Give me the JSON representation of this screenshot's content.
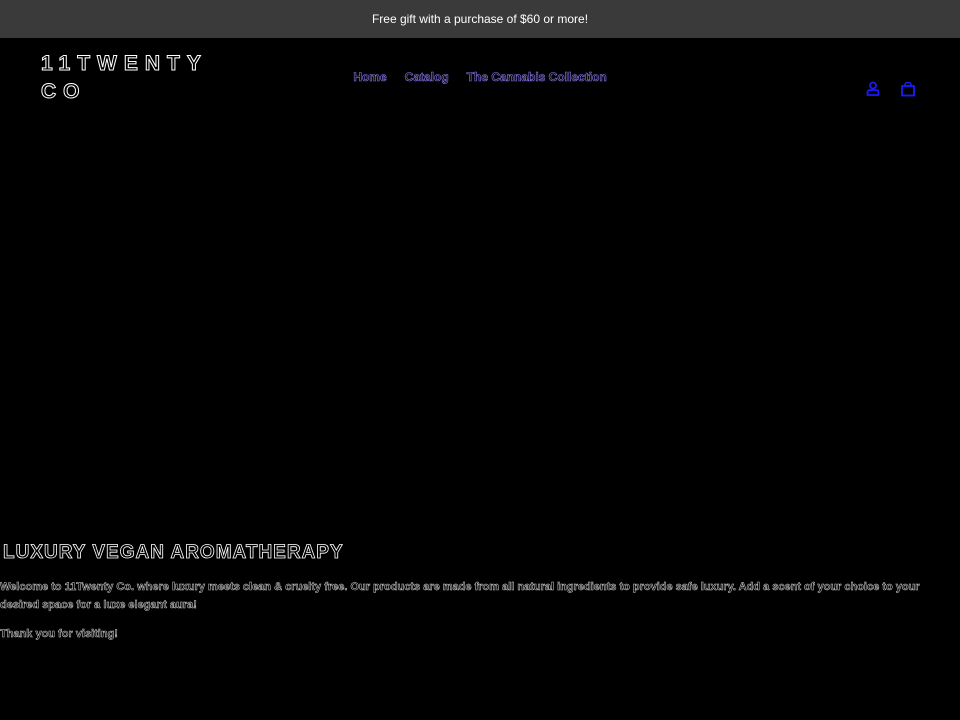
{
  "announcement": {
    "text": "Free gift with a purchase of $60 or more!"
  },
  "header": {
    "logo_text": "11TWENTY\nCO",
    "nav": [
      {
        "label": "Home"
      },
      {
        "label": "Catalog"
      },
      {
        "label": "The Cannabis Collection"
      }
    ],
    "icons": {
      "account": "user-icon",
      "cart": "bag-icon"
    },
    "accent_color": "#1a1aff"
  },
  "hero": {
    "title": "LUXURY VEGAN AROMATHERAPY",
    "body": "Welcome to 11Twenty Co. where luxury meets clean & cruelty free. Our products are made from all natural ingredients to provide safe luxury. Add a scent of your choice to your desired space for a luxe elegant aura!",
    "thanks": "Thank you for visiting!"
  }
}
